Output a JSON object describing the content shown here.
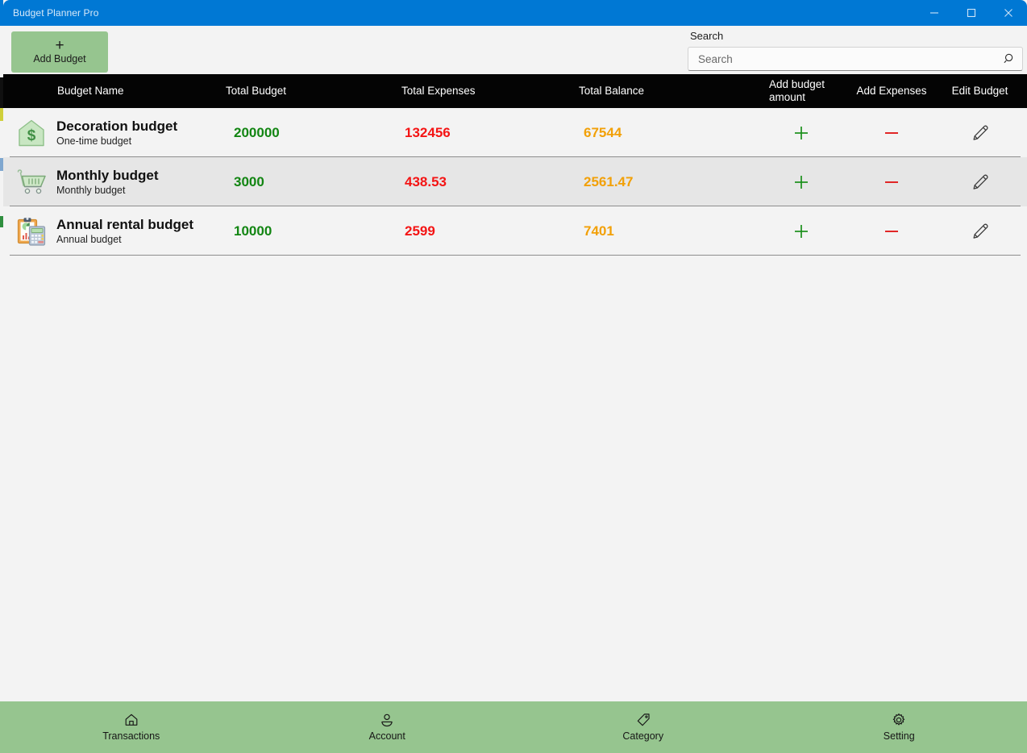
{
  "window": {
    "title": "Budget Planner Pro",
    "accent_color": "#0078d4",
    "controls": [
      {
        "name": "minimize",
        "label": "Minimize"
      },
      {
        "name": "maximize",
        "label": "Maximize"
      },
      {
        "name": "close",
        "label": "Close"
      }
    ]
  },
  "toolbar": {
    "add_budget_label": "Add Budget",
    "add_budget_plus": "+",
    "add_budget_color": "#96c58f"
  },
  "search": {
    "label": "Search",
    "placeholder": "Search",
    "value": "",
    "icon": "search-icon"
  },
  "table": {
    "header_background": "#040404",
    "columns": [
      {
        "key": "name",
        "label": "Budget Name"
      },
      {
        "key": "budget",
        "label": "Total Budget"
      },
      {
        "key": "expense",
        "label": "Total Expenses"
      },
      {
        "key": "balance",
        "label": "Total Balance"
      },
      {
        "key": "addamt",
        "label": "Add budget amount"
      },
      {
        "key": "addexp",
        "label": "Add Expenses"
      },
      {
        "key": "edit",
        "label": "Edit Budget"
      }
    ],
    "value_colors": {
      "total_budget": "#128512",
      "total_expenses": "#f41414",
      "total_balance": "#f2a007"
    },
    "action_icons": {
      "add_budget_amount": "plus-icon",
      "add_expenses": "minus-icon",
      "edit_budget": "pencil-icon"
    },
    "rows": [
      {
        "icon": "house-dollar-icon",
        "name": "Decoration budget",
        "subtitle": "One-time budget",
        "total_budget": "200000",
        "total_expenses": "132456",
        "total_balance": "67544",
        "selected": false
      },
      {
        "icon": "shopping-cart-icon",
        "name": "Monthly budget",
        "subtitle": "Monthly budget",
        "total_budget": "3000",
        "total_expenses": "438.53",
        "total_balance": "2561.47",
        "selected": true
      },
      {
        "icon": "clipboard-calculator-icon",
        "name": "Annual rental budget",
        "subtitle": "Annual budget",
        "total_budget": "10000",
        "total_expenses": "2599",
        "total_balance": "7401",
        "selected": false
      }
    ]
  },
  "bottom_nav": {
    "background": "#96c58f",
    "items": [
      {
        "icon": "home-icon",
        "label": "Transactions"
      },
      {
        "icon": "person-icon",
        "label": "Account"
      },
      {
        "icon": "tag-icon",
        "label": "Category"
      },
      {
        "icon": "gear-icon",
        "label": "Setting"
      }
    ]
  }
}
